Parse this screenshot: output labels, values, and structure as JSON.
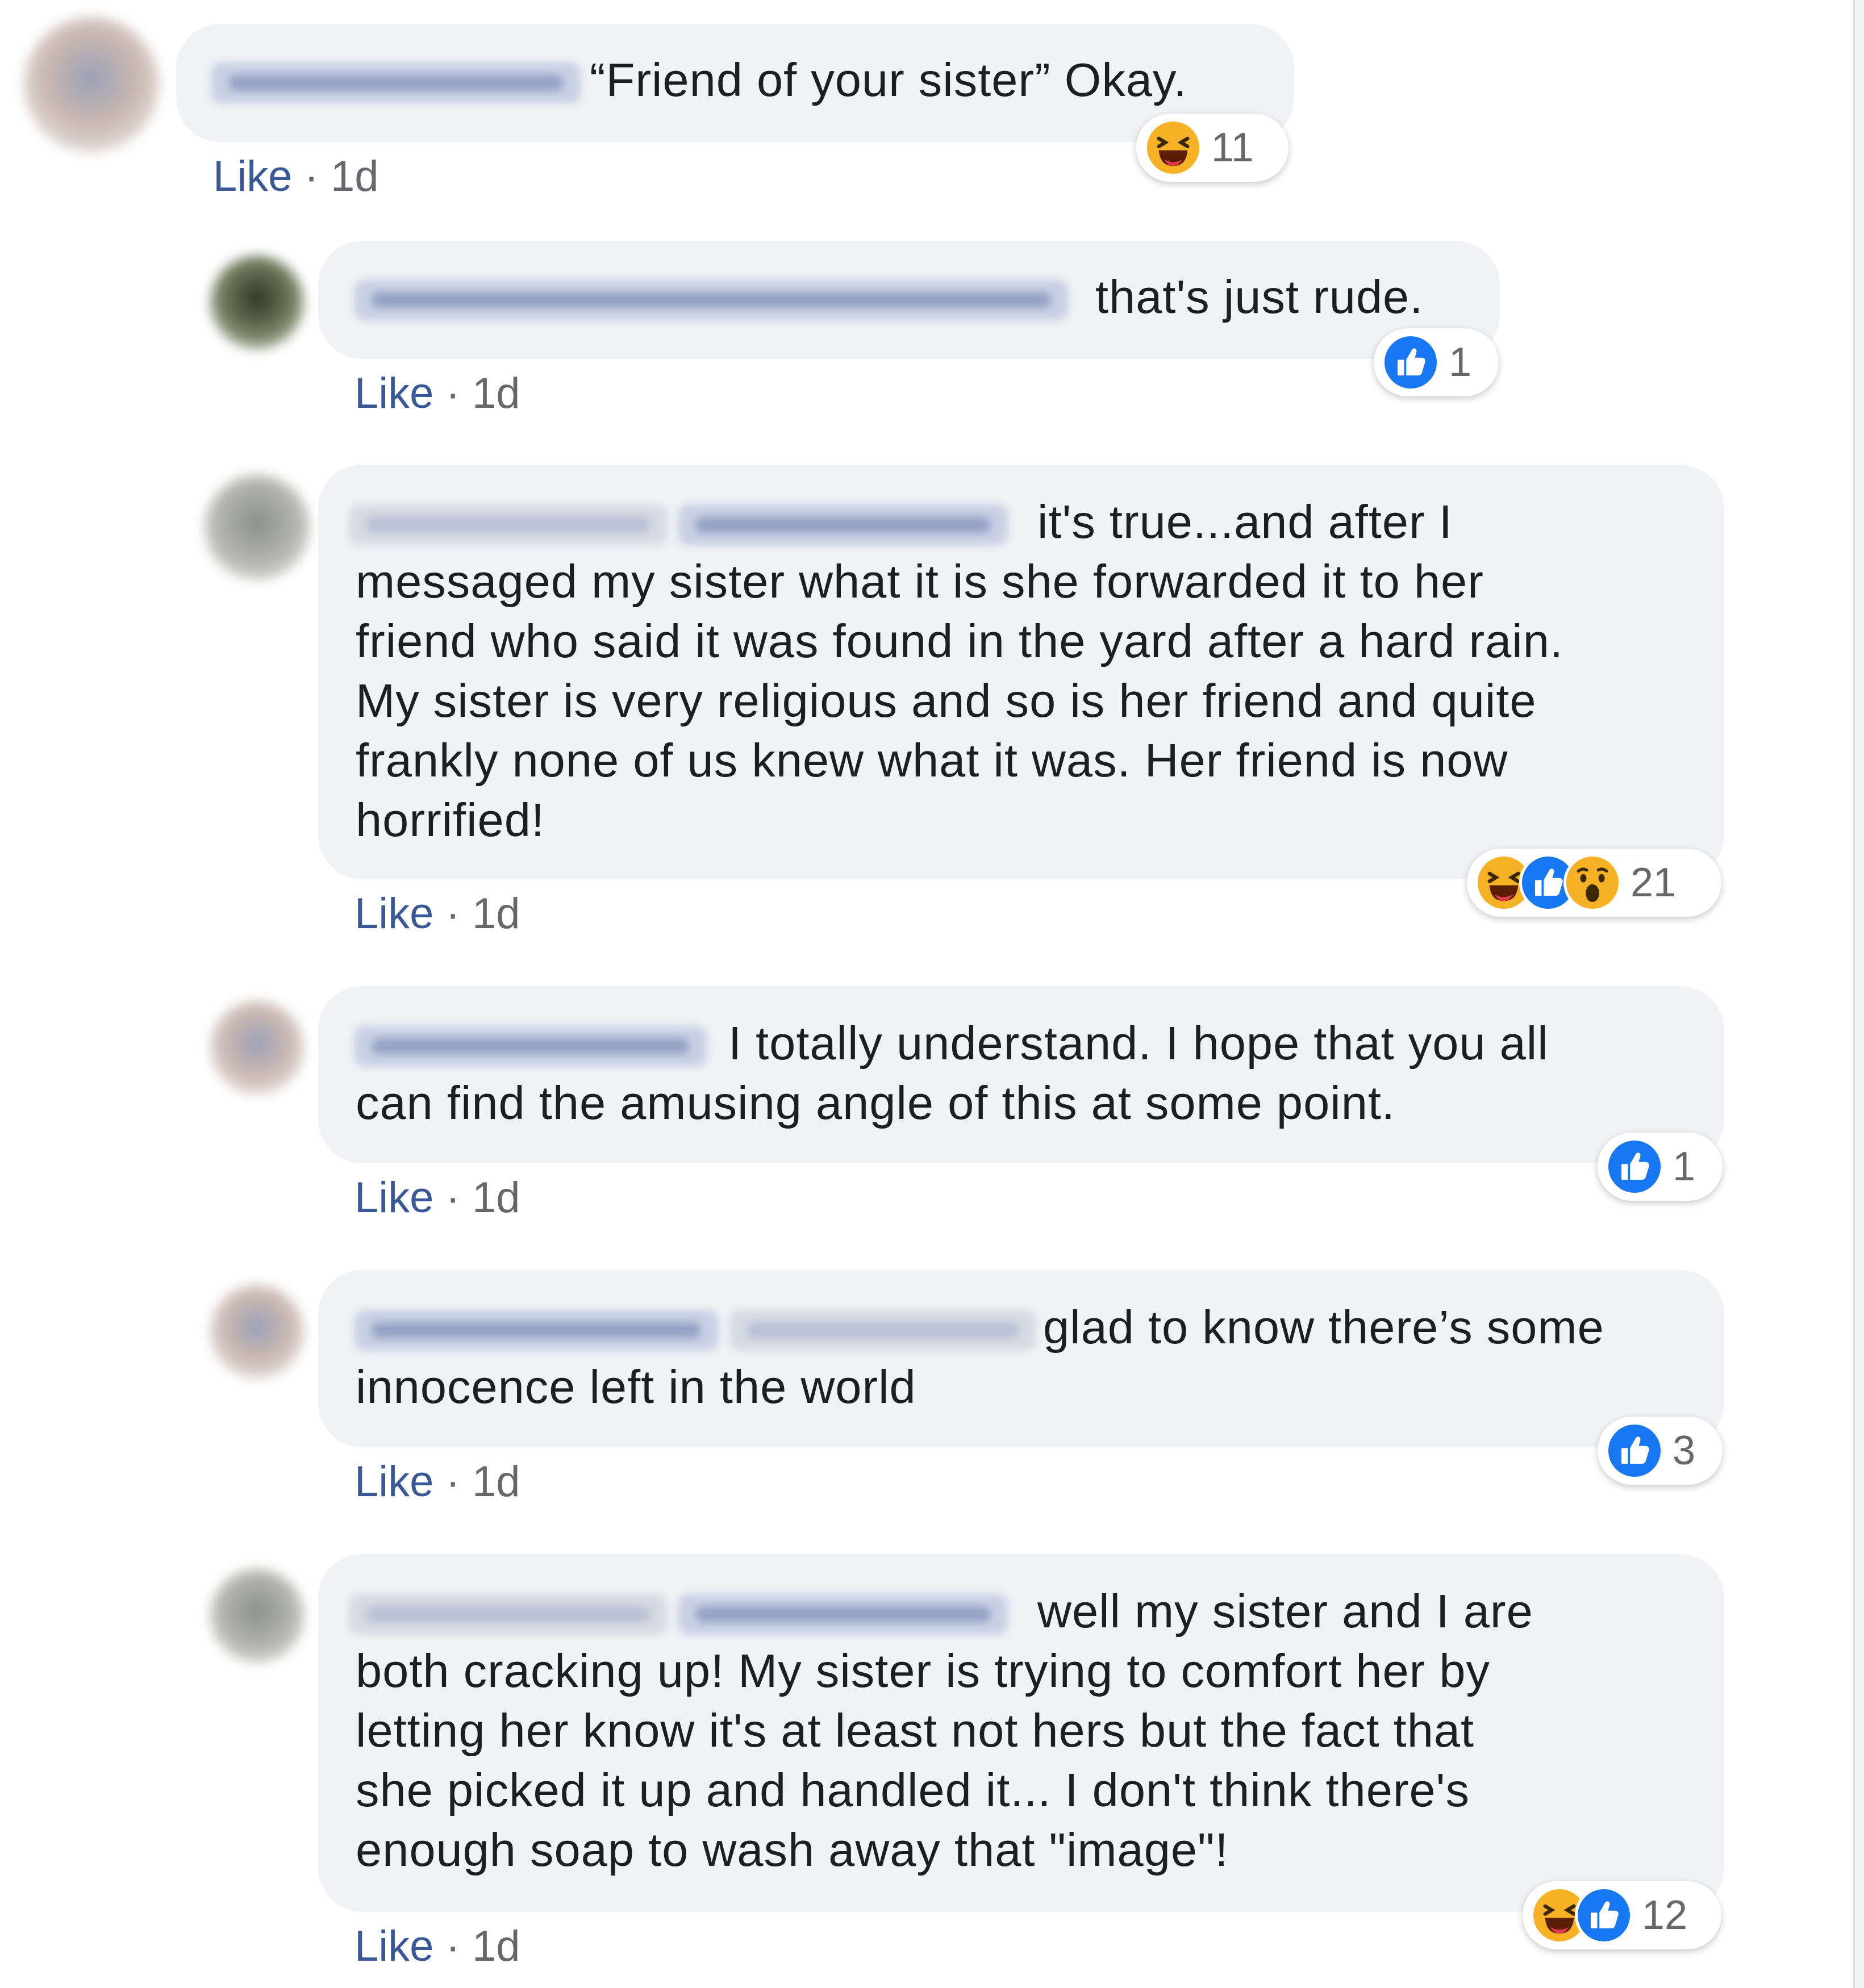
{
  "thread": {
    "comments": [
      {
        "name_hidden": true,
        "text": "“Friend of your sister” Okay.",
        "like_label": "Like",
        "separator": "·",
        "time": "1d",
        "reactions": [
          "haha-icon"
        ],
        "reaction_count": "11"
      },
      {
        "name_hidden": true,
        "text": "that's just rude.",
        "like_label": "Like",
        "separator": "·",
        "time": "1d",
        "reactions": [
          "like-icon"
        ],
        "reaction_count": "1"
      },
      {
        "name_hidden": true,
        "text_lines": [
          "it's true...and after I",
          "messaged my sister what it is she forwarded it to her",
          "friend who said it was found in the yard after a hard rain.",
          "My sister is very religious and so is her friend and quite",
          "frankly none of us knew what it was. Her friend is now",
          "horrified!"
        ],
        "like_label": "Like",
        "separator": "·",
        "time": "1d",
        "reactions": [
          "haha-icon",
          "like-icon",
          "wow-icon"
        ],
        "reaction_count": "21"
      },
      {
        "name_hidden": true,
        "text_lines": [
          "I totally understand. I hope that you all",
          "can find the amusing angle of this at some point."
        ],
        "like_label": "Like",
        "separator": "·",
        "time": "1d",
        "reactions": [
          "like-icon"
        ],
        "reaction_count": "1"
      },
      {
        "name_hidden": true,
        "text_lines": [
          "glad to know there’s some",
          "innocence left in the world"
        ],
        "like_label": "Like",
        "separator": "·",
        "time": "1d",
        "reactions": [
          "like-icon"
        ],
        "reaction_count": "3"
      },
      {
        "name_hidden": true,
        "text_lines": [
          "well my sister and I are",
          "both cracking up! My sister is trying to comfort her by",
          "letting her know it's at least not hers but the fact that",
          "she picked it up and handled it... I don't think there's",
          "enough soap to wash away that \"image\"!"
        ],
        "like_label": "Like",
        "separator": "·",
        "time": "1d",
        "reactions": [
          "haha-icon",
          "like-icon"
        ],
        "reaction_count": "12"
      }
    ]
  },
  "colors": {
    "bubble": "#f0f2f5",
    "text": "#1c1e21",
    "like_link": "#385898",
    "meta": "#65676b",
    "like_blue": "#1877f2",
    "haha_yellow": "#f7b125"
  }
}
